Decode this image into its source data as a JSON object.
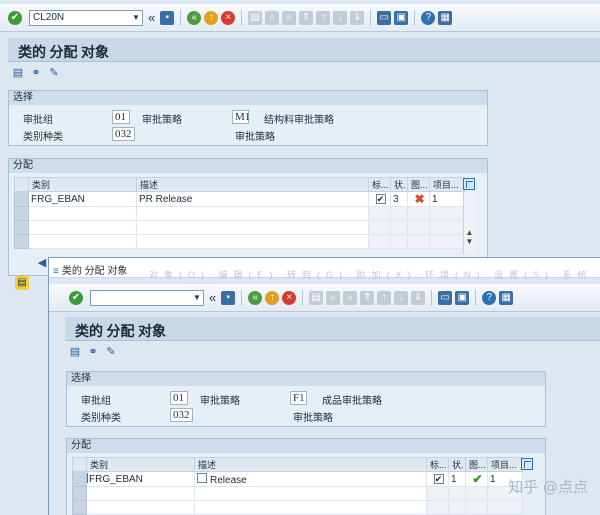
{
  "back": {
    "command_value": "CL20N",
    "title": "类的 分配 对象",
    "selection": {
      "title": "选择",
      "labels": {
        "approval_group": "审批组",
        "approval_strategy": "审批策略",
        "class_type": "类别种类",
        "approval_strategy2": "审批策略"
      },
      "values": {
        "approval_group": "01",
        "approval_strategy": "M1",
        "strategy_desc": "结构料审批策略",
        "class_type": "032"
      }
    },
    "assignment": {
      "title": "分配",
      "headers": [
        "类别",
        "描述",
        "标...",
        "状.",
        "图...",
        "项目..."
      ],
      "rows": [
        {
          "class": "FRG_EBAN",
          "desc": "PR Release",
          "std": "✔",
          "status": "3",
          "item": "1"
        }
      ]
    }
  },
  "front": {
    "window_title": "类的 分配 对象",
    "menu_ghost": "对象(O) 编辑(E) 转到(G) 附加(X) 环境(N) 设置(S) 系统(Y) 帮助(H)",
    "command_value": "",
    "title": "类的 分配 对象",
    "selection": {
      "title": "选择",
      "labels": {
        "approval_group": "审批组",
        "approval_strategy": "审批策略",
        "class_type": "类别种类",
        "approval_strategy2": "审批策略"
      },
      "values": {
        "approval_group": "01",
        "approval_strategy": "F1",
        "strategy_desc": "成品审批策略",
        "class_type": "032"
      }
    },
    "assignment": {
      "title": "分配",
      "headers": [
        "类别",
        "描述",
        "标...",
        "状.",
        "图...",
        "项目..."
      ],
      "rows": [
        {
          "class": "FRG_EBAN",
          "desc": "Release",
          "std": "✔",
          "status": "1",
          "item": "1"
        }
      ]
    }
  },
  "watermark": "知乎 @点点",
  "colors": {
    "accent": "#2f6fb3",
    "status_red": "#d64a1f",
    "status_green": "#2e9a2a"
  }
}
